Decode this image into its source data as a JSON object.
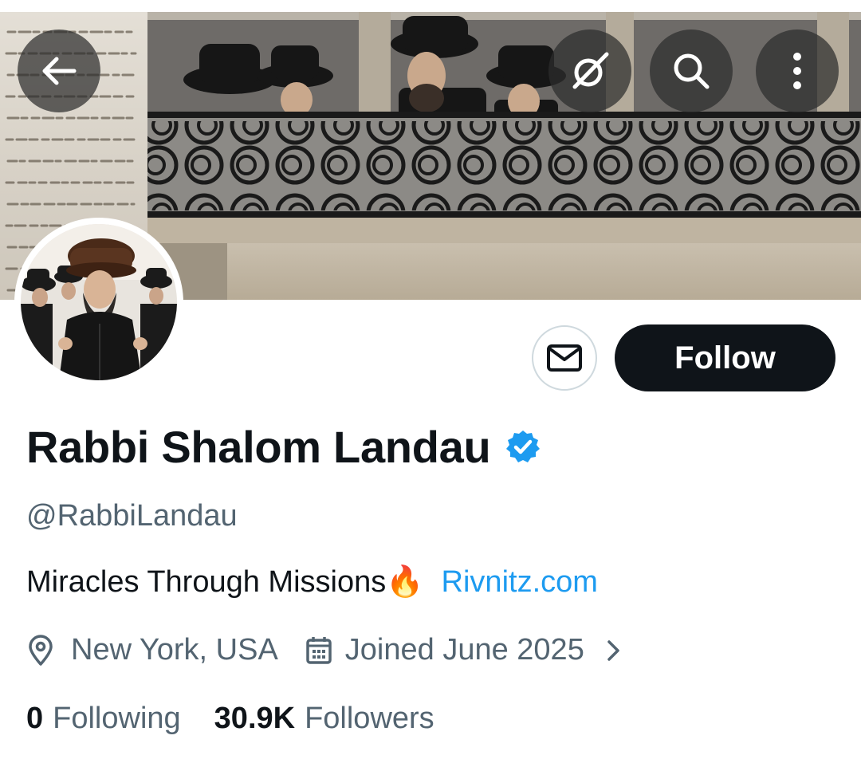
{
  "header": {
    "back_icon": "arrow-left-icon",
    "grok_icon": "grok-icon",
    "search_icon": "search-icon",
    "more_icon": "more-vertical-icon"
  },
  "profile": {
    "name": "Rabbi Shalom Landau",
    "verified": true,
    "handle": "@RabbiLandau",
    "bio_text": "Miracles Through Missions🔥",
    "bio_link": "Rivnitz.com",
    "location": "New York, USA",
    "joined": "Joined June 2025",
    "following_count": "0",
    "following_label": "Following",
    "followers_count": "30.9K",
    "followers_label": "Followers"
  },
  "actions": {
    "message_icon": "envelope-icon",
    "follow_label": "Follow"
  },
  "colors": {
    "accent": "#1d9bf0",
    "primary_text": "#0f1419",
    "secondary_text": "#536471",
    "follow_bg": "#0f1419"
  }
}
